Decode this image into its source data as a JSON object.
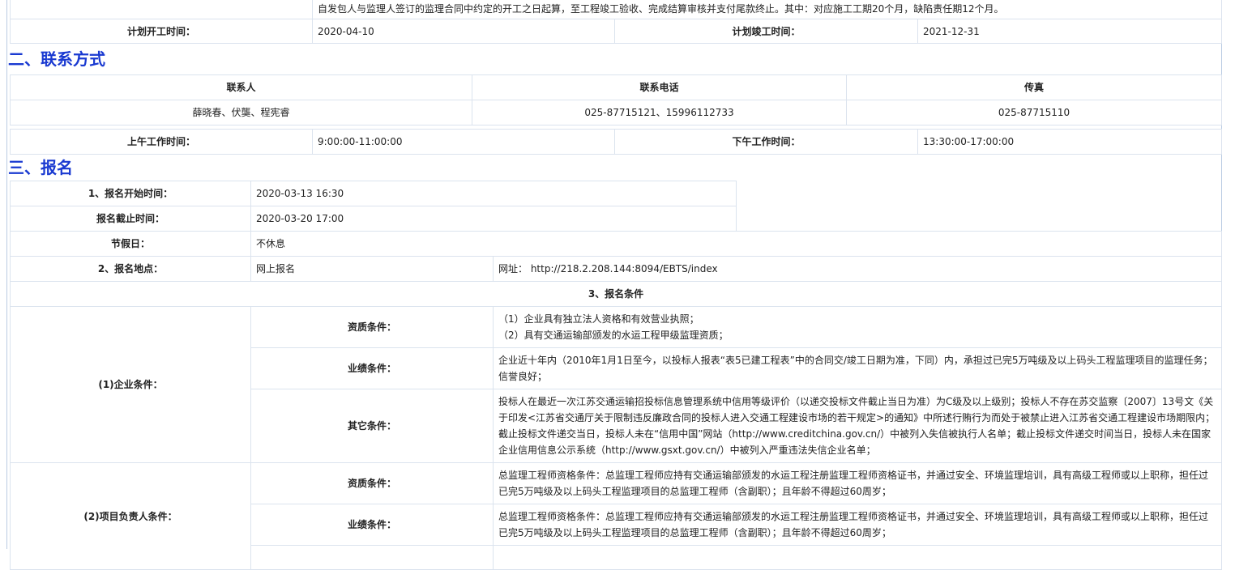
{
  "top": {
    "continuation_text": "自发包人与监理人签订的监理合同中约定的开工之日起算，至工程竣工验收、完成结算审核并支付尾款终止。其中：对应施工工期20个月，缺陷责任期12个月。",
    "plan_start_label": "计划开工时间：",
    "plan_start_value": "2020-04-10",
    "plan_end_label": "计划竣工时间：",
    "plan_end_value": "2021-12-31"
  },
  "contact": {
    "title": "二、联系方式",
    "headers": [
      "联系人",
      "联系电话",
      "传真"
    ],
    "row": [
      "薛晓春、伏龑、程宪睿",
      "025-87715121、15996112733",
      "025-87715110"
    ],
    "am_label": "上午工作时间：",
    "am_value": "9:00:00-11:00:00",
    "pm_label": "下午工作时间：",
    "pm_value": "13:30:00-17:00:00"
  },
  "signup": {
    "title": "三、报名",
    "start_label": "1、报名开始时间：",
    "start_value": "2020-03-13 16:30",
    "end_label": "报名截止时间：",
    "end_value": "2020-03-20 17:00",
    "holiday_label": "节假日：",
    "holiday_value": "不休息",
    "place_label": "2、报名地点：",
    "place_value": "网上报名",
    "url_text": "网址： http://218.2.208.144:8094/EBTS/index",
    "conditions_title": "3、报名条件",
    "enterprise_label": "(1)企业条件：",
    "qual_label": "资质条件：",
    "perf_label": "业绩条件：",
    "other_label": "其它条件：",
    "ent_qual_line1": "（1）企业具有独立法人资格和有效营业执照；",
    "ent_qual_line2": "（2）具有交通运输部颁发的水运工程甲级监理资质；",
    "ent_perf": "企业近十年内（2010年1月1日至今，以投标人报表“表5已建工程表”中的合同交/竣工日期为准，下同）内，承担过已完5万吨级及以上码头工程监理项目的监理任务；信誉良好；",
    "ent_other": "投标人在最近一次江苏交通运输招投标信息管理系统中信用等级评价（以递交投标文件截止当日为准）为C级及以上级别；投标人不存在苏交监察〔2007〕13号文《关于印发<江苏省交通厅关于限制违反廉政合同的投标人进入交通工程建设市场的若干规定>的通知》中所述行贿行为而处于被禁止进入江苏省交通工程建设市场期限内；截止投标文件递交当日，投标人未在“信用中国”网站（http://www.creditchina.gov.cn/）中被列入失信被执行人名单；截止投标文件递交时间当日，投标人未在国家企业信用信息公示系统（http://www.gsxt.gov.cn/）中被列入严重违法失信企业名单；",
    "pm_cond_label": "(2)项目负责人条件：",
    "pm_qual": "总监理工程师资格条件：总监理工程师应持有交通运输部颁发的水运工程注册监理工程师资格证书，并通过安全、环境监理培训，具有高级工程师或以上职称，担任过已完5万吨级及以上码头工程监理项目的总监理工程师（含副职）；且年龄不得超过60周岁；",
    "pm_perf": "总监理工程师资格条件：总监理工程师应持有交通运输部颁发的水运工程注册监理工程师资格证书，并通过安全、环境监理培训，具有高级工程师或以上职称，担任过已完5万吨级及以上码头工程监理项目的总监理工程师（含副职）；且年龄不得超过60周岁；"
  }
}
